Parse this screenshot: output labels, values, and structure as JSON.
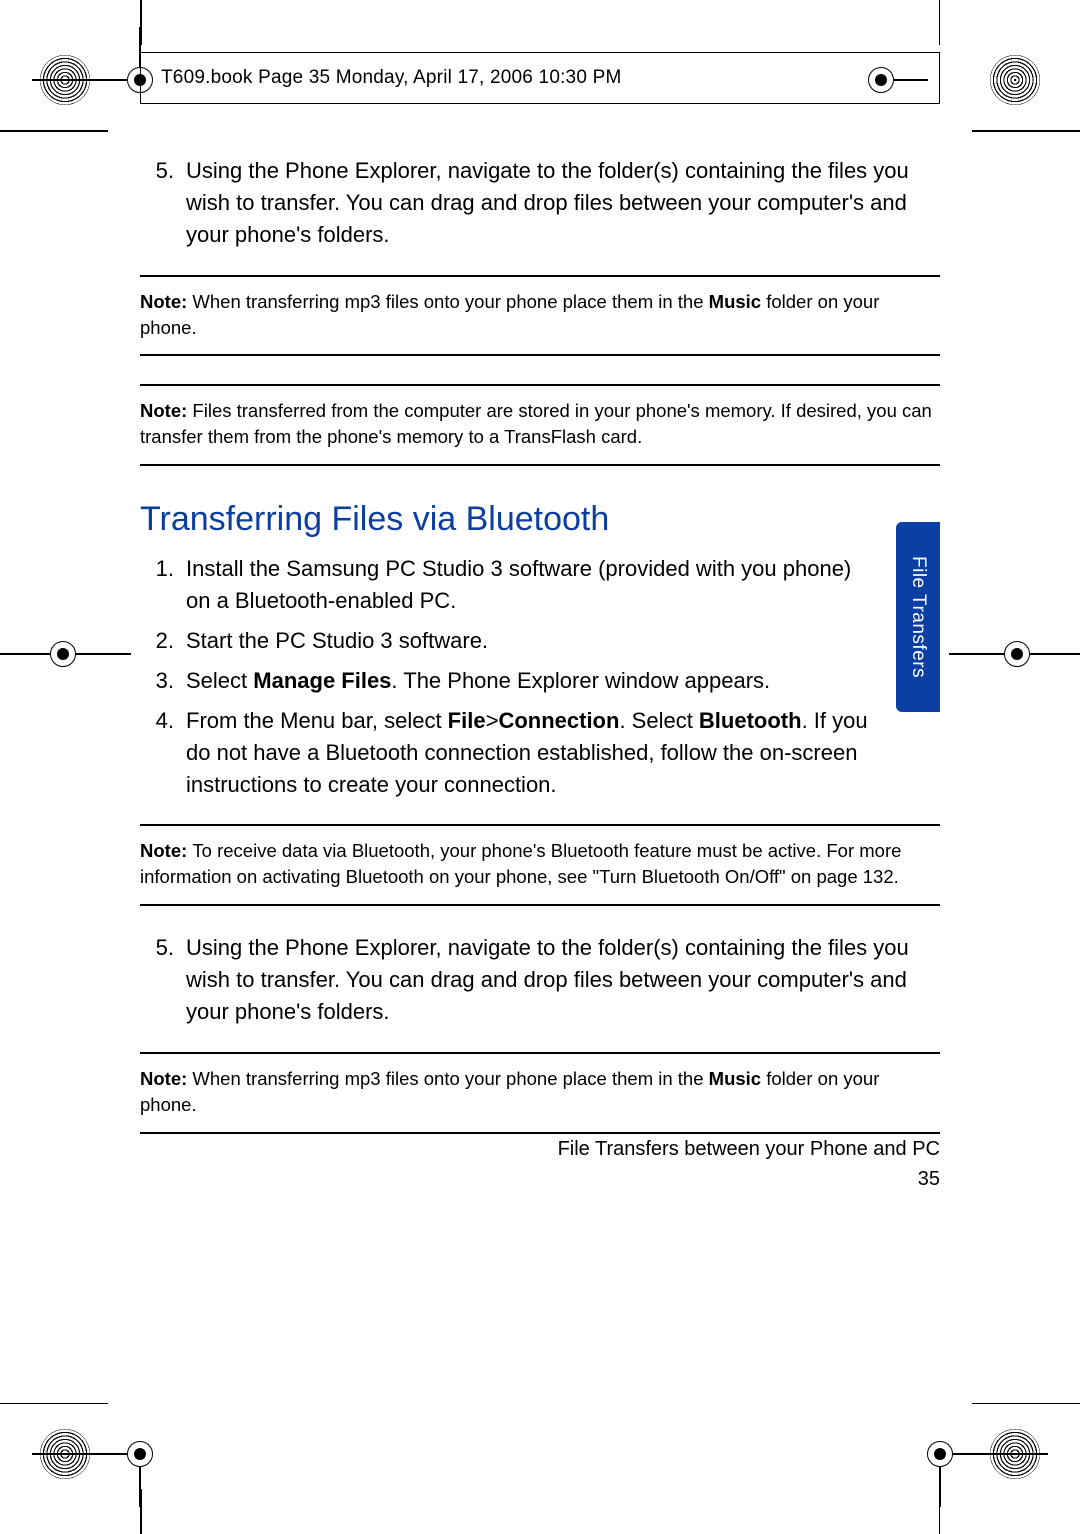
{
  "header": {
    "text": "T609.book  Page 35  Monday, April 17, 2006  10:30 PM"
  },
  "steps_top": {
    "num": "5.",
    "text": "Using the Phone Explorer, navigate to the folder(s) containing the files you wish to transfer. You can drag and drop files between your computer's and your phone's folders."
  },
  "note1_prefix": "Note: ",
  "note1_a": "When transferring mp3 files onto your phone place them in the ",
  "note1_bold": "Music",
  "note1_b": " folder on your phone.",
  "note2_prefix": "Note: ",
  "note2_text": "Files transferred from the computer are stored in your phone's memory. If desired, you can transfer them from the phone's memory to a TransFlash card.",
  "section_title": "Transferring Files via Bluetooth",
  "bt_steps": [
    {
      "num": "1.",
      "text": "Install the Samsung PC Studio 3 software (provided with you phone) on a Bluetooth-enabled PC."
    },
    {
      "num": "2.",
      "text": "Start the PC Studio 3 software."
    },
    {
      "num": "3.",
      "pre": "Select ",
      "bold1": "Manage Files",
      "post": ". The Phone Explorer window appears."
    },
    {
      "num": "4.",
      "pre": "From the Menu bar, select ",
      "bold1": "File",
      "mid1": ">",
      "bold2": "Connection",
      "mid2": ". Select ",
      "bold3": "Bluetooth",
      "post": ". If you do not have a Bluetooth connection established, follow the on-screen instructions to create your connection."
    }
  ],
  "note3_prefix": "Note: ",
  "note3_text": "To receive data via Bluetooth, your phone's Bluetooth feature must be active. For more information on activating Bluetooth on your phone, see \"Turn Bluetooth On/Off\" on page 132.",
  "step5b": {
    "num": "5.",
    "text": "Using the Phone Explorer, navigate to the folder(s) containing the files you wish to transfer. You can drag and drop files between your computer's and your phone's folders."
  },
  "note4_prefix": "Note: ",
  "note4_a": "When transferring mp3 files onto your phone place them in the ",
  "note4_bold": "Music",
  "note4_b": " folder on your phone.",
  "side_tab": "File Transfers",
  "footer_line1": "File Transfers between your Phone and PC",
  "footer_line2": "35"
}
